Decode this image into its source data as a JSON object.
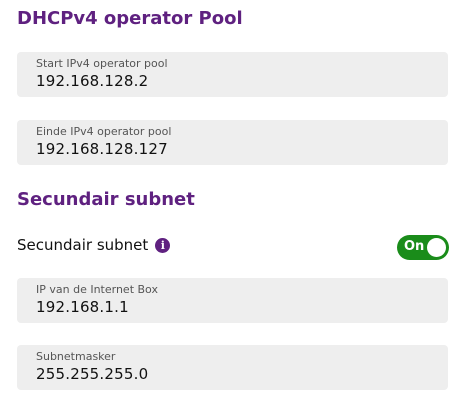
{
  "sections": {
    "dhcp_pool_title": "DHCPv4 operator Pool",
    "secondary_subnet_title": "Secundair subnet"
  },
  "fields": {
    "start_pool": {
      "label": "Start IPv4 operator pool",
      "value": "192.168.128.2"
    },
    "end_pool": {
      "label": "Einde IPv4 operator pool",
      "value": "192.168.128.127"
    },
    "internet_box_ip": {
      "label": "IP van de Internet Box",
      "value": "192.168.1.1"
    },
    "subnet_mask": {
      "label": "Subnetmasker",
      "value": "255.255.255.0"
    }
  },
  "secondary_subnet_toggle": {
    "label": "Secundair subnet",
    "state_text": "On",
    "enabled": true,
    "info_icon": "info-icon"
  },
  "colors": {
    "accent_purple": "#5f2180",
    "toggle_green": "#1a8c1a",
    "field_background": "#eeeeee"
  }
}
